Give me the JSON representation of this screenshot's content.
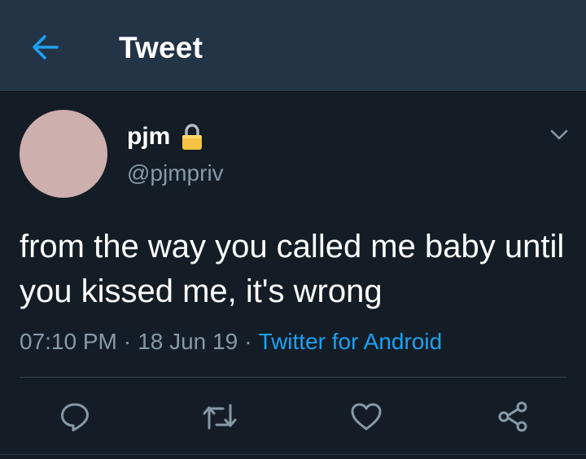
{
  "header": {
    "title": "Tweet",
    "back_icon": "arrow-left-icon"
  },
  "tweet": {
    "display_name": "pjm",
    "handle": "@pjmpriv",
    "protected_icon": "lock-icon",
    "menu_icon": "chevron-down-icon",
    "text": "from the way you called me baby until you kissed me, it's wrong",
    "time": "07:10 PM",
    "separator": "·",
    "date": "18 Jun 19",
    "source": "Twitter for Android"
  },
  "actions": [
    {
      "name": "reply",
      "icon": "reply-icon"
    },
    {
      "name": "retweet",
      "icon": "retweet-icon"
    },
    {
      "name": "like",
      "icon": "heart-icon"
    },
    {
      "name": "share",
      "icon": "share-icon"
    }
  ],
  "colors": {
    "background": "#141d26",
    "header": "#243447",
    "accent": "#1da1f2",
    "secondary_text": "#8899a6",
    "avatar": "#cdafad"
  }
}
